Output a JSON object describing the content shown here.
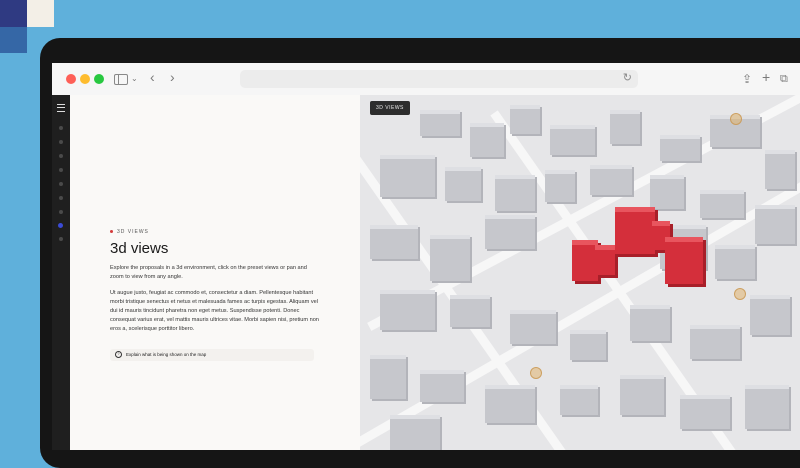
{
  "app": {
    "eyebrow": "3D VIEWS",
    "title": "3d views",
    "intro": "Explore the proposals in a 3d environment, click on the preset views or pan and zoom to view from any angle.",
    "body": "Ut augue justo, feugiat ac commodo et, consectetur a diam. Pellentesque habitant morbi tristique senectus et netus et malesuada fames ac turpis egestas. Aliquam vel dui id mauris tincidunt pharetra non eget metus. Suspendisse potenti. Donec consequat varius erat, vel mattis mauris ultrices vitae. Morbi sapien nisi, pretium non eros a, scelerisque porttitor libero.",
    "help_label": "Explain what is being shown on the map"
  },
  "map": {
    "badge": "3D VIEWS"
  },
  "colors": {
    "accent_red": "#d42f3b",
    "active_dot": "#3b4bd6"
  },
  "icons": [
    "sidebar-icon",
    "chevron-down-icon",
    "back-icon",
    "forward-icon",
    "reload-icon",
    "share-icon",
    "plus-icon",
    "tabs-icon",
    "menu-icon",
    "help-icon"
  ]
}
